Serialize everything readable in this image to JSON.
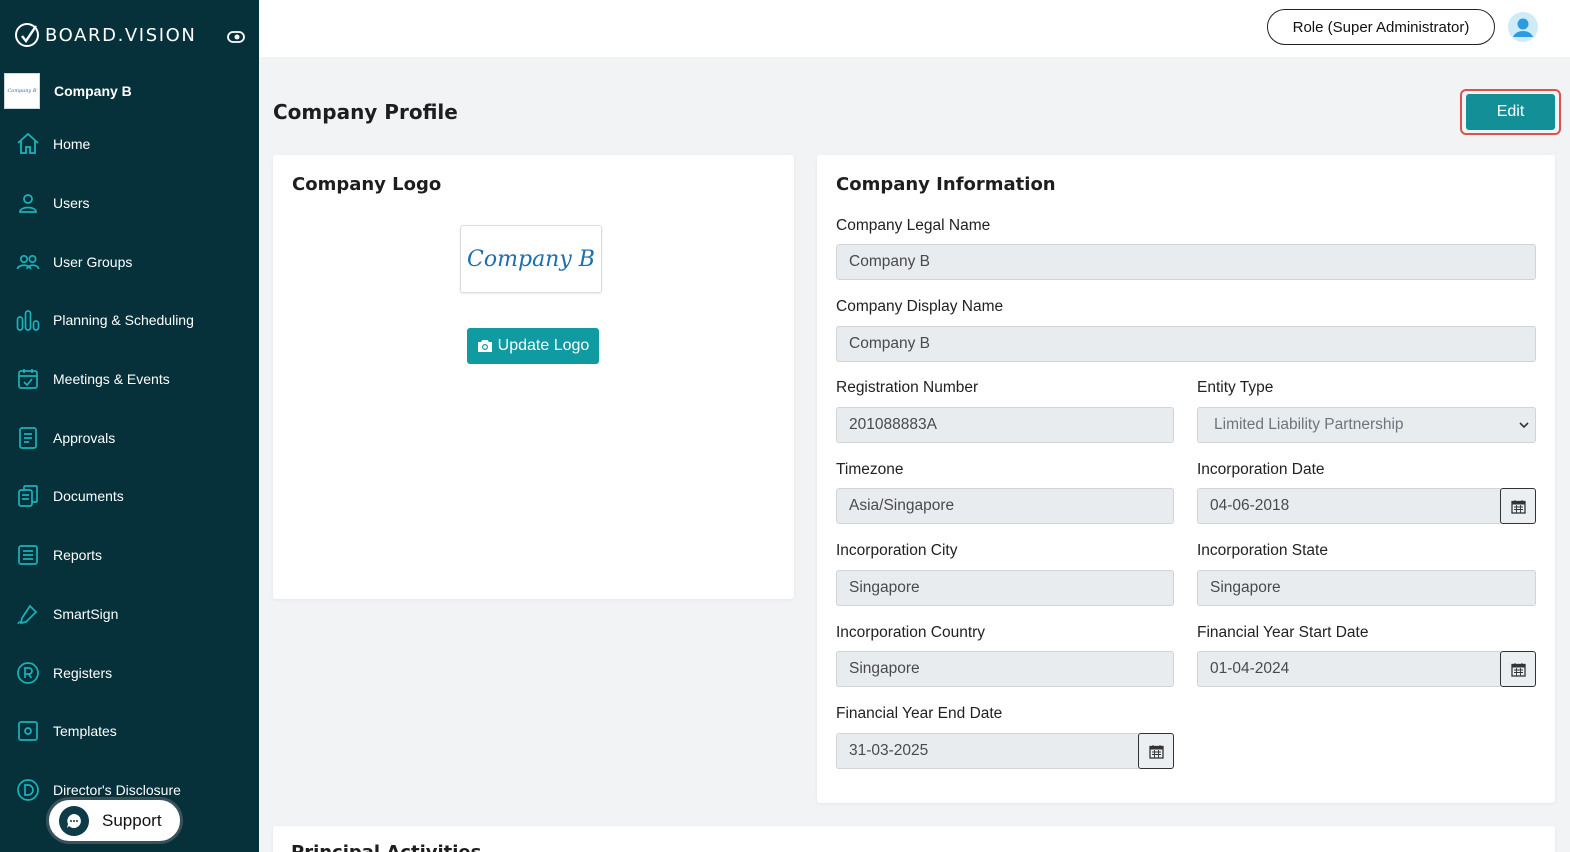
{
  "brand": {
    "name": "BOARD.VISION"
  },
  "sidebar": {
    "company": {
      "name": "Company B",
      "thumb_text": "Company B"
    },
    "items": [
      {
        "label": "Home",
        "icon": "home-icon"
      },
      {
        "label": "Users",
        "icon": "user-icon"
      },
      {
        "label": "User Groups",
        "icon": "user-group-icon"
      },
      {
        "label": "Planning & Scheduling",
        "icon": "bar-chart-icon"
      },
      {
        "label": "Meetings & Events",
        "icon": "calendar-check-icon"
      },
      {
        "label": "Approvals",
        "icon": "document-list-icon"
      },
      {
        "label": "Documents",
        "icon": "documents-icon"
      },
      {
        "label": "Reports",
        "icon": "report-icon"
      },
      {
        "label": "SmartSign",
        "icon": "signature-pen-icon"
      },
      {
        "label": "Registers",
        "icon": "registered-icon"
      },
      {
        "label": "Templates",
        "icon": "template-icon"
      },
      {
        "label": "Director's Disclosure",
        "icon": "disclosure-d-icon"
      }
    ],
    "support_label": "Support"
  },
  "topbar": {
    "role": "Role (Super Administrator)"
  },
  "page": {
    "title": "Company Profile",
    "edit_label": "Edit"
  },
  "logo_card": {
    "title": "Company Logo",
    "logo_text": "Company B",
    "update_label": "Update Logo"
  },
  "info_card": {
    "title": "Company Information",
    "legal_name": {
      "label": "Company Legal Name",
      "value": "Company B"
    },
    "display_name": {
      "label": "Company Display Name",
      "value": "Company B"
    },
    "registration": {
      "label": "Registration Number",
      "value": "201088883A"
    },
    "entity_type": {
      "label": "Entity Type",
      "value": "Limited Liability Partnership"
    },
    "timezone": {
      "label": "Timezone",
      "value": "Asia/Singapore"
    },
    "incorporation_date": {
      "label": "Incorporation Date",
      "value": "04-06-2018"
    },
    "incorporation_city": {
      "label": "Incorporation City",
      "value": "Singapore"
    },
    "incorporation_state": {
      "label": "Incorporation State",
      "value": "Singapore"
    },
    "incorporation_country": {
      "label": "Incorporation Country",
      "value": "Singapore"
    },
    "fy_start": {
      "label": "Financial Year Start Date",
      "value": "01-04-2024"
    },
    "fy_end": {
      "label": "Financial Year End Date",
      "value": "31-03-2025"
    }
  },
  "bottom_card": {
    "title": "Principal Activities"
  },
  "colors": {
    "sidebar": "#06303a",
    "accent": "#138f97",
    "highlight": "#d9534f"
  }
}
